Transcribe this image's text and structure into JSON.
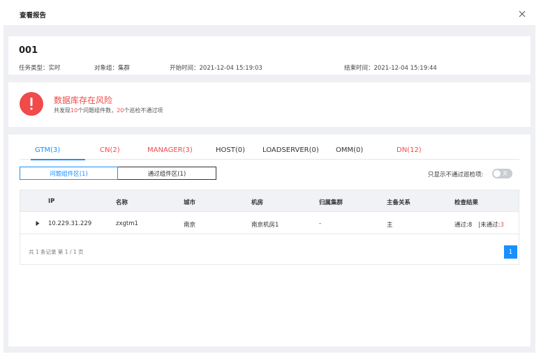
{
  "dialog": {
    "title": "查看报告"
  },
  "task": {
    "id": "001",
    "type": "任务类型：实时",
    "object_group": "对象组：集群",
    "start_time": "开始时间：2021-12-04 15:19:03",
    "end_time": "结束时间：2021-12-04 15:19:44"
  },
  "risk": {
    "title": "数据库存在风险",
    "summary_prefix": "共发现",
    "problem_count": "10",
    "summary_mid": "个问题组件数，",
    "fail_count": "20",
    "summary_suffix": "个巡检不通过项"
  },
  "tabs": [
    {
      "label": "GTM(3)",
      "state": "active"
    },
    {
      "label": "CN(2)",
      "state": "risk"
    },
    {
      "label": "MANAGER(3)",
      "state": "risk"
    },
    {
      "label": "HOST(0)",
      "state": "normal"
    },
    {
      "label": "LOADSERVER(0)",
      "state": "normal"
    },
    {
      "label": "OMM(0)",
      "state": "normal"
    },
    {
      "label": "DN(12)",
      "state": "risk"
    }
  ],
  "segments": [
    {
      "label": "问题组件区(1)",
      "active": true
    },
    {
      "label": "通过组件区(1)",
      "active": false
    }
  ],
  "filter": {
    "label": "只显示不通过巡检项:",
    "toggle_text": "关",
    "enabled": false
  },
  "table": {
    "headers": [
      "IP",
      "名称",
      "城市",
      "机房",
      "归属集群",
      "主备关系",
      "检查结果"
    ],
    "rows": [
      {
        "ip": "10.229.31.229",
        "name": "zxgtm1",
        "city": "南京",
        "room": "南京机房1",
        "cluster": "-",
        "role": "主",
        "pass": "通过:8",
        "fail_label": "|未通过:",
        "fail_value": "3"
      }
    ]
  },
  "pagination": {
    "info": "共 1 条记录  第 1 / 1 页",
    "current_page": "1"
  },
  "colors": {
    "accent": "#1890ff",
    "danger": "#f04a4a",
    "background": "#eef0f3"
  }
}
